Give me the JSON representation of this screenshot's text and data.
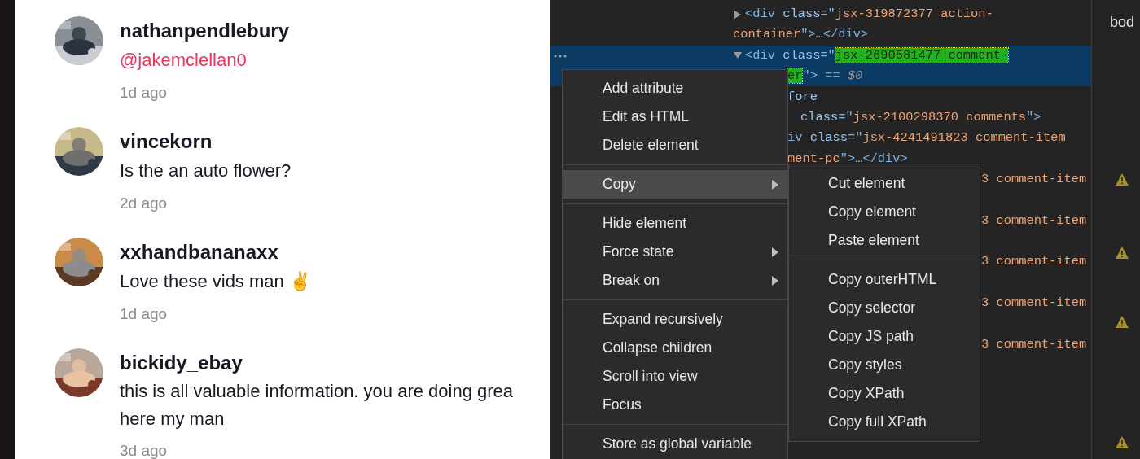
{
  "comments": [
    {
      "username": "nathanpendlebury",
      "body": [
        {
          "kind": "mention",
          "text": "@jakemclellan0"
        }
      ],
      "time": "1d ago",
      "avatar": {
        "kind": "picture"
      }
    },
    {
      "username": "vincekorn",
      "body": [
        {
          "kind": "text",
          "text": "Is the an auto flower?"
        }
      ],
      "time": "2d ago",
      "avatar": {
        "kind": "picture"
      }
    },
    {
      "username": "xxhandbananaxx",
      "body": [
        {
          "kind": "text",
          "text": "Love these vids man ✌"
        }
      ],
      "time": "1d ago",
      "avatar": {
        "kind": "picture"
      }
    },
    {
      "username": "bickidy_ebay",
      "body": [
        {
          "kind": "text",
          "text": "this is all valuable information. you are doing grea"
        },
        {
          "kind": "text",
          "text": "here my man"
        }
      ],
      "time": "3d ago",
      "avatar": {
        "kind": "picture"
      }
    }
  ],
  "elements_panel": {
    "lines": [
      {
        "expanded": false,
        "selected": false,
        "tokens": [
          {
            "kind": "tag",
            "text": "<div"
          },
          {
            "kind": "attr",
            "text": " class"
          },
          {
            "kind": "tag",
            "text": "=\""
          },
          {
            "kind": "value",
            "text": "jsx-319872377 action-"
          }
        ]
      },
      {
        "selected": false,
        "tokens": [
          {
            "kind": "value",
            "text": "container"
          },
          {
            "kind": "tag",
            "text": "\">"
          },
          {
            "kind": "plain",
            "text": "…"
          },
          {
            "kind": "tag",
            "text": "</div>"
          }
        ]
      },
      {
        "expanded": true,
        "selected": true,
        "tokens": [
          {
            "kind": "tag",
            "text": "<div"
          },
          {
            "kind": "attr",
            "text": " class"
          },
          {
            "kind": "tag",
            "text": "=\""
          },
          {
            "kind": "match",
            "text": "jsx-2690581477 comment-"
          }
        ]
      },
      {
        "selected": true,
        "tokens": [
          {
            "kind": "match",
            "text": "er"
          },
          {
            "kind": "tag",
            "text": "\">"
          },
          {
            "kind": "ref",
            "text": " == $0"
          }
        ]
      },
      {
        "selected": false,
        "tokens": [
          {
            "kind": "attr",
            "text": "fore"
          }
        ]
      },
      {
        "selected": false,
        "tokens": [
          {
            "kind": "attr",
            "text": "class"
          },
          {
            "kind": "tag",
            "text": "=\""
          },
          {
            "kind": "value",
            "text": "jsx-2100298370 comments"
          },
          {
            "kind": "tag",
            "text": "\">"
          }
        ]
      },
      {
        "selected": false,
        "tokens": [
          {
            "kind": "tag",
            "text": "iv"
          },
          {
            "kind": "attr",
            "text": " class"
          },
          {
            "kind": "tag",
            "text": "=\""
          },
          {
            "kind": "value",
            "text": "jsx-4241491823 comment-item"
          }
        ]
      },
      {
        "selected": false,
        "tokens": [
          {
            "kind": "value",
            "text": "ment-pc"
          },
          {
            "kind": "tag",
            "text": "\">"
          },
          {
            "kind": "plain",
            "text": "…"
          },
          {
            "kind": "tag",
            "text": "</div>"
          }
        ]
      },
      {
        "selected": false,
        "tokens": [
          {
            "kind": "value",
            "text": "3 comment-item"
          }
        ]
      },
      {
        "selected": false,
        "tokens": [
          {
            "kind": "value",
            "text": "3 comment-item"
          }
        ]
      },
      {
        "selected": false,
        "tokens": [
          {
            "kind": "value",
            "text": "3 comment-item"
          }
        ]
      },
      {
        "selected": false,
        "tokens": [
          {
            "kind": "value",
            "text": "3 comment-item"
          }
        ]
      },
      {
        "selected": false,
        "tokens": [
          {
            "kind": "value",
            "text": "3 comment-item"
          }
        ]
      }
    ]
  },
  "side_panel": {
    "text": "bod"
  },
  "context_menu": {
    "groups": [
      [
        {
          "label": "Add attribute",
          "selected": false
        },
        {
          "label": "Edit as HTML",
          "selected": false
        },
        {
          "label": "Delete element",
          "selected": false
        }
      ],
      [
        {
          "label": "Copy",
          "selected": true,
          "has_submenu": true
        }
      ],
      [
        {
          "label": "Hide element",
          "selected": false
        },
        {
          "label": "Force state",
          "selected": false,
          "has_submenu": true
        },
        {
          "label": "Break on",
          "selected": false,
          "has_submenu": true
        }
      ],
      [
        {
          "label": "Expand recursively",
          "selected": false
        },
        {
          "label": "Collapse children",
          "selected": false
        },
        {
          "label": "Scroll into view",
          "selected": false
        },
        {
          "label": "Focus",
          "selected": false
        }
      ],
      [
        {
          "label": "Store as global variable",
          "selected": false
        }
      ]
    ]
  },
  "submenu": {
    "groups": [
      [
        {
          "label": "Cut element"
        },
        {
          "label": "Copy element"
        },
        {
          "label": "Paste element"
        }
      ],
      [
        {
          "label": "Copy outerHTML"
        },
        {
          "label": "Copy selector"
        },
        {
          "label": "Copy JS path"
        },
        {
          "label": "Copy styles"
        },
        {
          "label": "Copy XPath"
        },
        {
          "label": "Copy full XPath"
        }
      ]
    ]
  }
}
